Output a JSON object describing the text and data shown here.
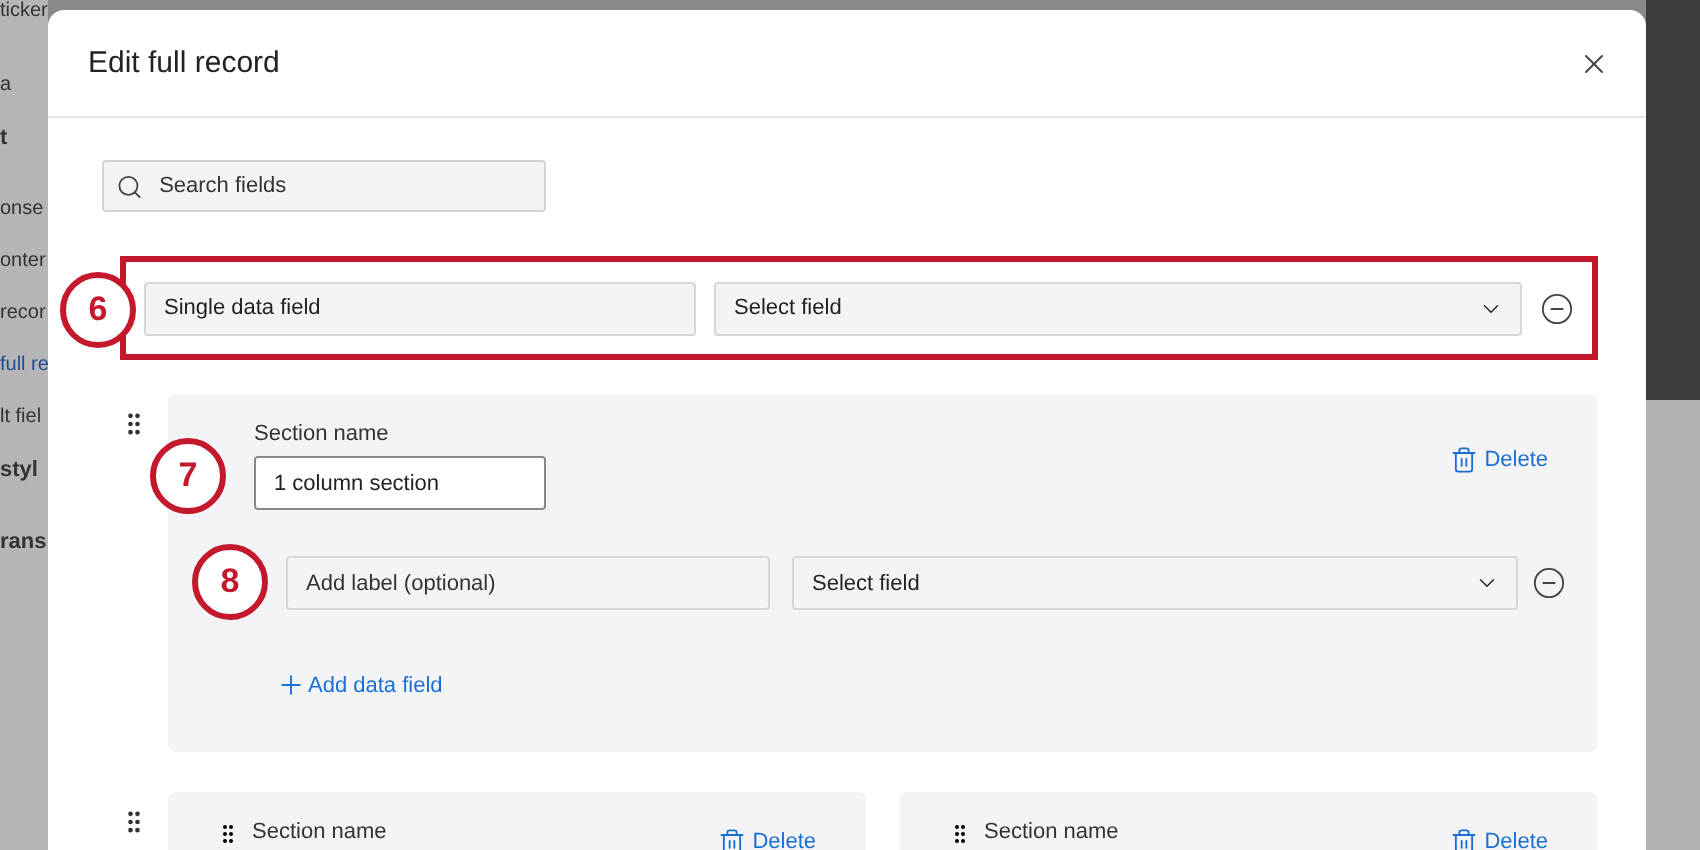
{
  "background": {
    "top_text": "ticker",
    "side_texts": [
      {
        "text": "a",
        "kind": "plain"
      },
      {
        "text": "t",
        "kind": "heading"
      },
      {
        "text": "onse",
        "kind": "plain"
      },
      {
        "text": "onter",
        "kind": "plain"
      },
      {
        "text": "recor",
        "kind": "plain"
      },
      {
        "text": "full re",
        "kind": "link"
      },
      {
        "text": "lt fiel",
        "kind": "plain"
      },
      {
        "text": "styl",
        "kind": "heading"
      },
      {
        "text": "rans",
        "kind": "heading"
      }
    ]
  },
  "modal": {
    "title": "Edit full record",
    "search": {
      "placeholder": "Search fields"
    },
    "single_field": {
      "highlighted": true,
      "badge": "6",
      "label_value": "Single data field",
      "select_value": "Select field"
    },
    "sections": [
      {
        "kind": "full",
        "badge": "7",
        "name_label": "Section name",
        "name_value": "1 column section",
        "delete_label": "Delete",
        "fields": [
          {
            "badge": "8",
            "label_placeholder": "Add label (optional)",
            "select_value": "Select field"
          }
        ],
        "add_label": "Add data field"
      },
      {
        "kind": "columns",
        "columns": [
          {
            "name_label": "Section name",
            "delete_label": "Delete"
          },
          {
            "name_label": "Section name",
            "delete_label": "Delete"
          }
        ]
      }
    ]
  }
}
